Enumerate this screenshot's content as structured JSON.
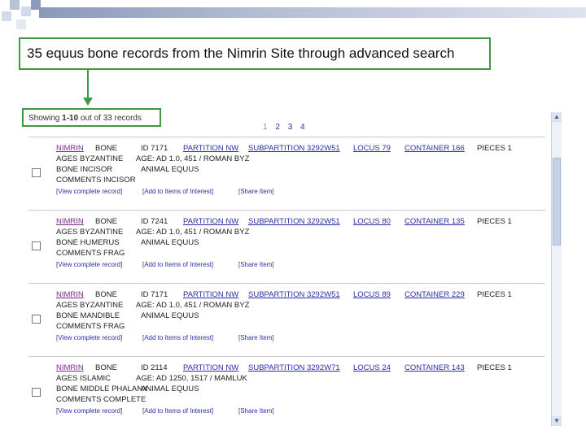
{
  "title": "35 equus  bone records from the Nimrin Site through advanced search",
  "showing": {
    "prefix": "Showing ",
    "range": "1-10",
    "suffix": " out of 33 records"
  },
  "pager": {
    "current": "1",
    "pages": [
      "2",
      "3",
      "4"
    ]
  },
  "actions": {
    "view": "[View complete record]",
    "add": "[Add to Items of Interest]",
    "share": "[Share Item]"
  },
  "records": [
    {
      "site": "Nimrin",
      "type": "Bone",
      "id": "ID 7171",
      "partition": "Partition NW",
      "subpartition": "Subpartition 3292W51",
      "locus": "Locus 79",
      "container": "Container 166",
      "pieces": "PIECES 1",
      "ages": "AGES BYZANTINE",
      "age_label": "AGE: AD 1.0, 451 / ROMAN BYZ",
      "bone": "BONE INCISOR",
      "animal": "ANIMAL EQUUS",
      "comments": "COMMENTS INCISOR"
    },
    {
      "site": "Nimrin",
      "type": "Bone",
      "id": "ID 7241",
      "partition": "Partition NW",
      "subpartition": "Subpartition 3292W51",
      "locus": "Locus 80",
      "container": "Container 135",
      "pieces": "PIECES 1",
      "ages": "AGES BYZANTINE",
      "age_label": "AGE: AD 1.0, 451 / ROMAN BYZ",
      "bone": "BONE HUMERUS",
      "animal": "ANIMAL EQUUS",
      "comments": "COMMENTS FRAG"
    },
    {
      "site": "Nimrin",
      "type": "Bone",
      "id": "ID 7171",
      "partition": "Partition NW",
      "subpartition": "Subpartition 3292W51",
      "locus": "Locus 89",
      "container": "Container 229",
      "pieces": "PIECES 1",
      "ages": "AGES BYZANTINE",
      "age_label": "AGE: AD 1.0, 451 / ROMAN BYZ",
      "bone": "BONE MANDIBLE",
      "animal": "ANIMAL EQUUS",
      "comments": "COMMENTS FRAG"
    },
    {
      "site": "Nimrin",
      "type": "Bone",
      "id": "ID 2114",
      "partition": "Partition NW",
      "subpartition": "Subpartition 3292W71",
      "locus": "Locus 24",
      "container": "Container 143",
      "pieces": "PIECES 1",
      "ages": "AGES ISLAMIC",
      "age_label": "AGE: AD 1250, 1517 / MAMLUK",
      "bone": "BONE MIDDLE PHALANX",
      "animal": "ANIMAL EQUUS",
      "comments": "COMMENTS COMPLETE"
    }
  ]
}
